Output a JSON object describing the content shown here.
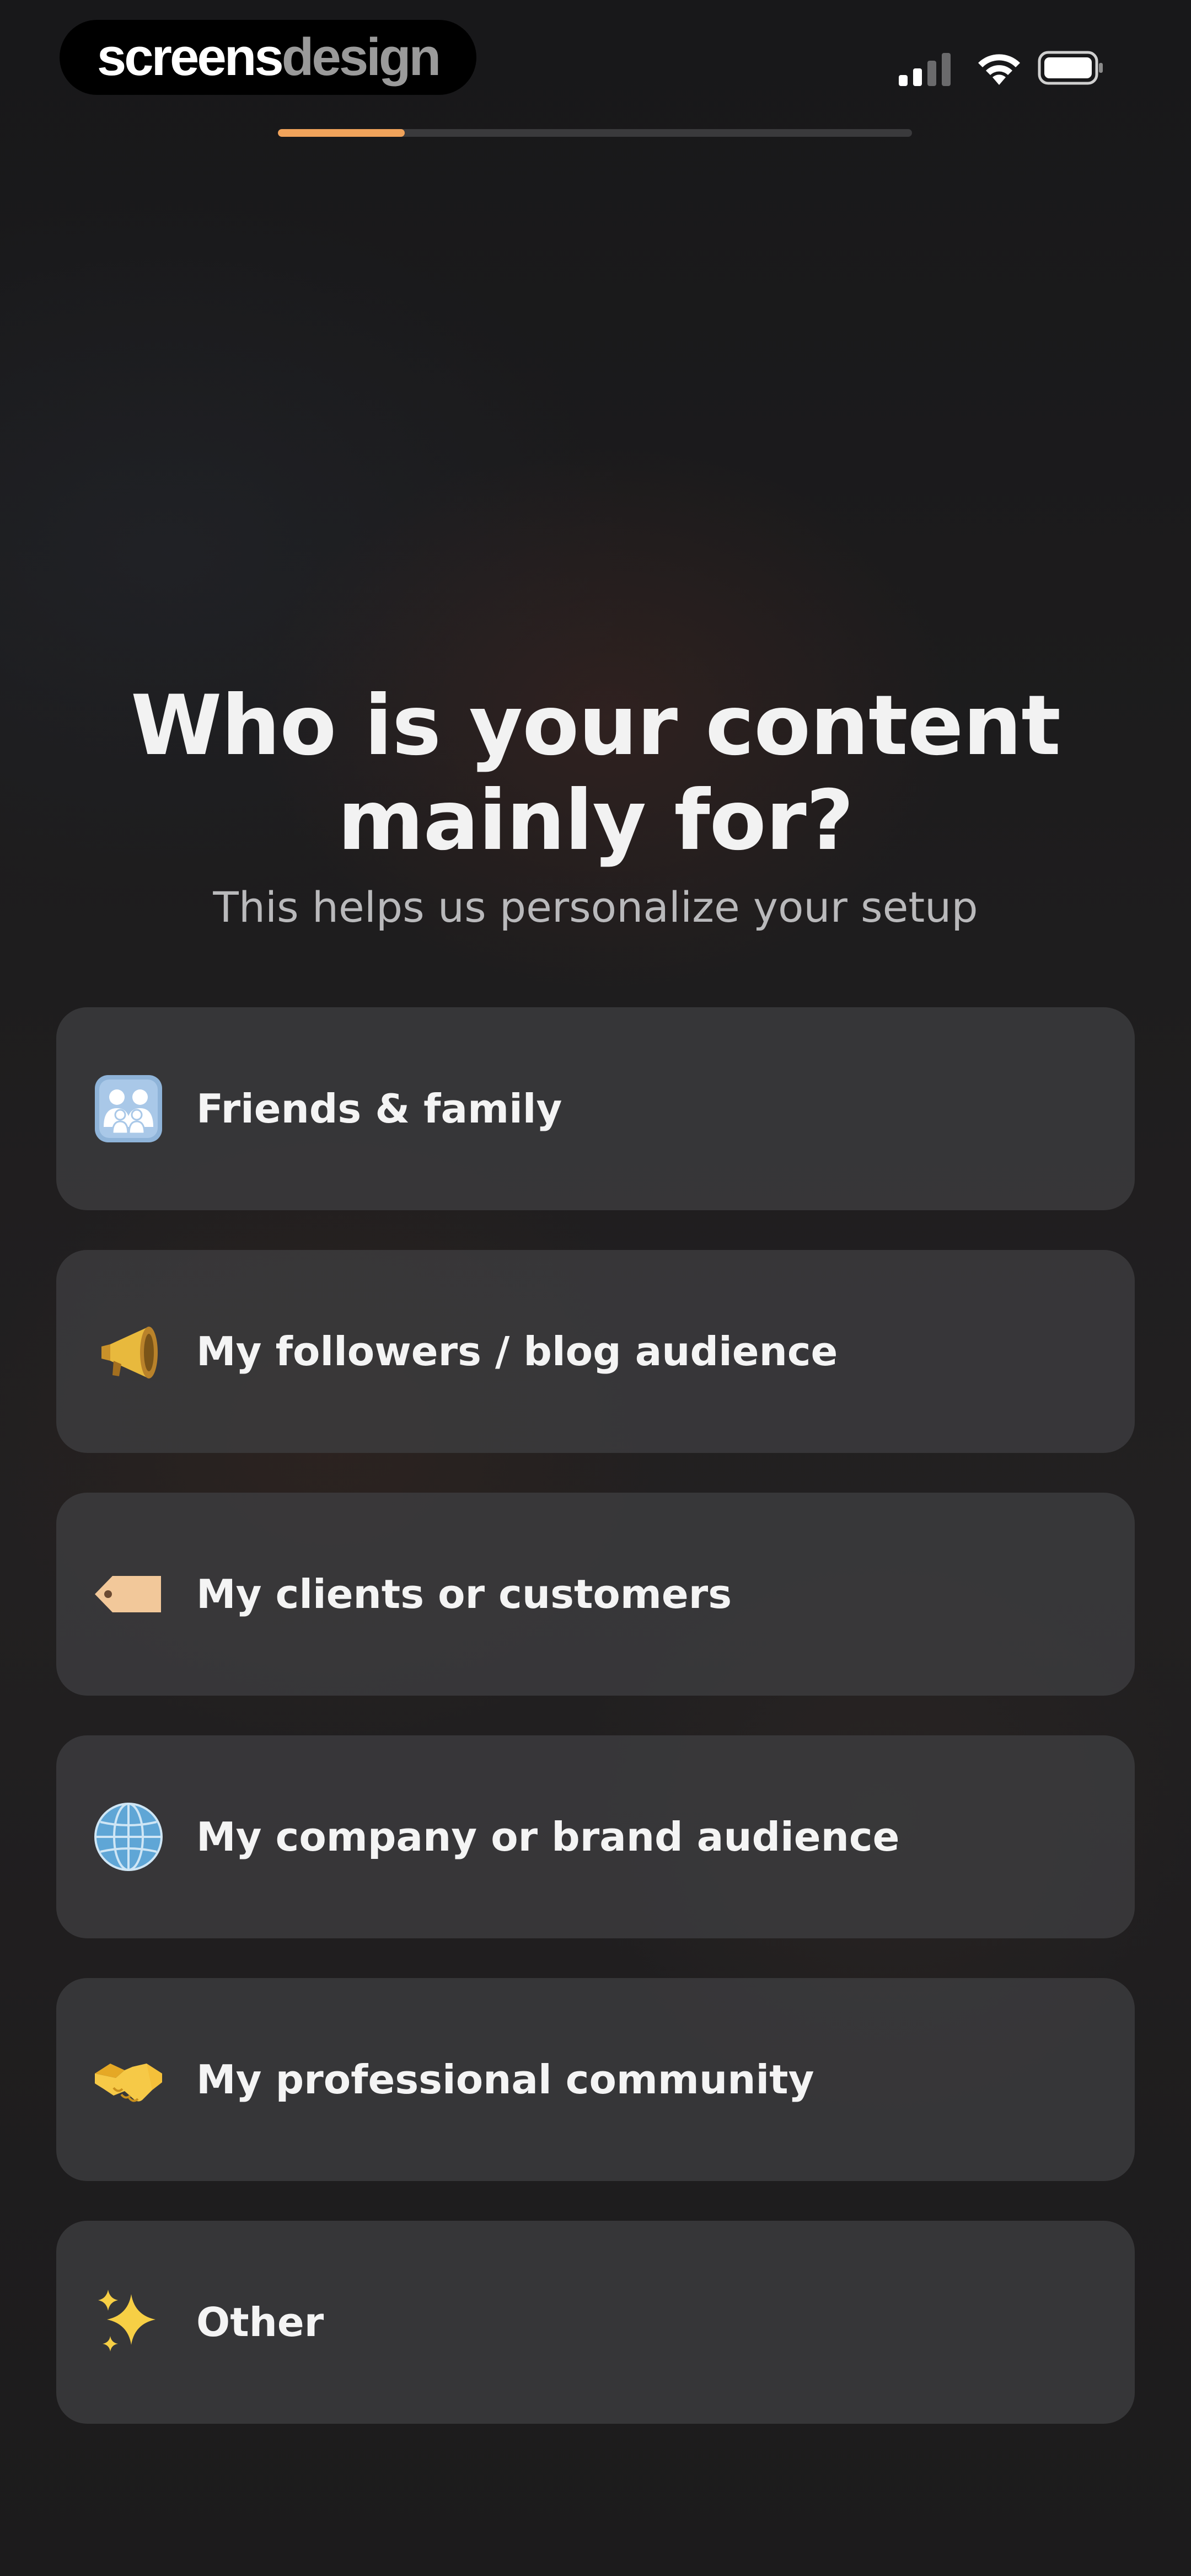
{
  "status_bar": {
    "brand_part1": "screens",
    "brand_part2": "design"
  },
  "progress": {
    "percent": 20,
    "color": "#f0a35b"
  },
  "heading": {
    "title": "Who is your content mainly for?",
    "subtitle": "This helps us personalize your setup"
  },
  "options": [
    {
      "label": "Friends & family",
      "icon": "family-icon"
    },
    {
      "label": "My followers / blog audience",
      "icon": "megaphone-icon"
    },
    {
      "label": "My clients or customers",
      "icon": "tag-icon"
    },
    {
      "label": "My company or brand audience",
      "icon": "globe-icon"
    },
    {
      "label": "My professional community",
      "icon": "handshake-icon"
    },
    {
      "label": "Other",
      "icon": "sparkles-icon"
    }
  ]
}
